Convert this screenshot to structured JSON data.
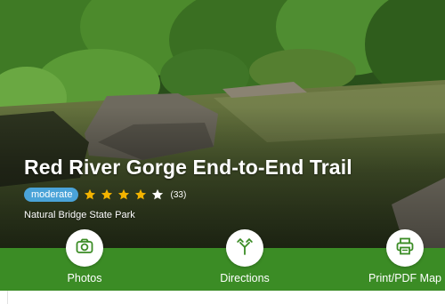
{
  "trail": {
    "title": "Red River Gorge End-to-End Trail",
    "difficulty": "moderate",
    "rating": 4,
    "rating_max": 5,
    "review_count": "(33)",
    "park": "Natural Bridge State Park"
  },
  "actions": {
    "photos": {
      "label": "Photos",
      "icon": "camera-icon"
    },
    "directions": {
      "label": "Directions",
      "icon": "directions-icon"
    },
    "print": {
      "label": "Print/PDF Map",
      "icon": "printer-icon"
    }
  },
  "colors": {
    "action_bar": "#3b8c25",
    "badge": "#4aa3d8",
    "star_filled": "#f4b400",
    "star_empty": "#ffffff"
  }
}
